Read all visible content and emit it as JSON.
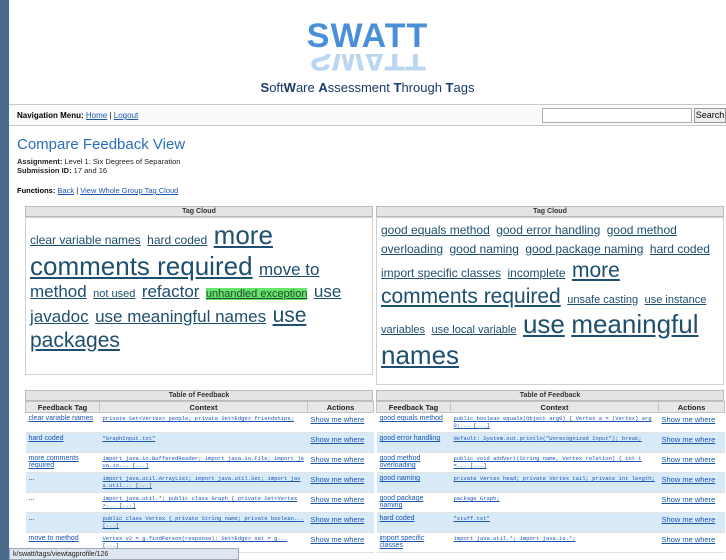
{
  "header": {
    "logo": "SWATT",
    "tagline_parts": [
      "S",
      "oft",
      "W",
      "are ",
      "A",
      "ssessment ",
      "T",
      "hrough ",
      "T",
      "ags"
    ]
  },
  "nav": {
    "label": "Navigation Menu:",
    "home": "Home",
    "sep": " | ",
    "logout": "Logout",
    "search_placeholder": "",
    "search_button": "Search"
  },
  "page": {
    "title": "Compare Feedback View",
    "assignment_label": "Assignment:",
    "assignment_value": " Level 1: Six Degrees of Separation",
    "submission_label": "Submission ID:",
    "submission_value": " 17 and 16",
    "functions_label": "Functions:",
    "back": "Back",
    "sep": " | ",
    "whole_cloud": "View Whole Group Tag Cloud"
  },
  "left": {
    "cloud_title": "Tag Cloud",
    "cloud": [
      {
        "text": "clear variable names",
        "size": 12,
        "hl": false
      },
      {
        "text": "hard coded",
        "size": 12,
        "hl": false
      },
      {
        "text": "more",
        "size": 26,
        "hl": false
      },
      {
        "text": "comments required",
        "size": 26,
        "hl": false
      },
      {
        "text": "move to",
        "size": 17,
        "hl": false
      },
      {
        "text": "method",
        "size": 17,
        "hl": false
      },
      {
        "text": "not used",
        "size": 11,
        "hl": false
      },
      {
        "text": "refactor",
        "size": 17,
        "hl": false
      },
      {
        "text": "unhandled exception",
        "size": 11,
        "hl": true
      },
      {
        "text": "use",
        "size": 17,
        "hl": false
      },
      {
        "text": "javadoc",
        "size": 17,
        "hl": false
      },
      {
        "text": "use meaningful names",
        "size": 17,
        "hl": false
      },
      {
        "text": "use",
        "size": 21,
        "hl": false
      },
      {
        "text": "packages",
        "size": 21,
        "hl": false
      }
    ],
    "table_title": "Table of Feedback",
    "headers": [
      "Feedback Tag",
      "Context",
      "Actions"
    ],
    "rows": [
      {
        "tag": "clear variable names",
        "ctx": "private Set<Vertex> people; private Set<Edge> friendships;",
        "act": "Show me where"
      },
      {
        "tag": "hard coded",
        "ctx": "\"GraphInput.txt\"",
        "act": "Show me where"
      },
      {
        "tag": "more comments required",
        "ctx": "import java.io.BufferedReader; import java.io.File; import java.io... [...]",
        "act": "Show me where"
      },
      {
        "tag": "...",
        "ctx": "import java.util.ArrayList; import java.util.Set; import java.util... [...]",
        "act": "Show me where"
      },
      {
        "tag": "...",
        "ctx": "import java.util.*; public class Graph { private Set<Vertex>... [...]",
        "act": "Show me where"
      },
      {
        "tag": "...",
        "ctx": "public class Vertex { private String name; private boolean... [...]",
        "act": "Show me where"
      },
      {
        "tag": "move to method",
        "ctx": "Vertex v2 = g.findPerson(response); Set<Edge> set = g... [...]",
        "act": "Show me where"
      }
    ]
  },
  "right": {
    "cloud_title": "Tag Cloud",
    "cloud": [
      {
        "text": "good equals method",
        "size": 12,
        "hl": false
      },
      {
        "text": "good error handling",
        "size": 12,
        "hl": false
      },
      {
        "text": "good method overloading",
        "size": 12,
        "hl": false
      },
      {
        "text": "good naming",
        "size": 12,
        "hl": false
      },
      {
        "text": "good package naming",
        "size": 12,
        "hl": false
      },
      {
        "text": "hard coded",
        "size": 12,
        "hl": false
      },
      {
        "text": "import specific classes",
        "size": 12,
        "hl": false
      },
      {
        "text": "incomplete",
        "size": 12,
        "hl": false
      },
      {
        "text": "more",
        "size": 21,
        "hl": false
      },
      {
        "text": "comments required",
        "size": 21,
        "hl": false
      },
      {
        "text": "unsafe casting",
        "size": 11,
        "hl": false
      },
      {
        "text": "use instance variables",
        "size": 11,
        "hl": false
      },
      {
        "text": "use local variable",
        "size": 11,
        "hl": false
      },
      {
        "text": "use",
        "size": 26,
        "hl": false
      },
      {
        "text": "meaningful names",
        "size": 26,
        "hl": false
      }
    ],
    "table_title": "Table of Feedback",
    "headers": [
      "Feedback Tag",
      "Context",
      "Actions"
    ],
    "rows": [
      {
        "tag": "good equals method",
        "ctx": "public boolean equals(Object arg0) { Vertex a = (Vertex) arg0;... [...]",
        "act": "Show me where"
      },
      {
        "tag": "good error handling",
        "ctx": "default: System.out.println(\"Unrecognized Input\"); break;",
        "act": "Show me where"
      },
      {
        "tag": "good method overloading",
        "ctx": "public void addVert(String name, Vertex relation) { int t =... [...]",
        "act": "Show me where"
      },
      {
        "tag": "good naming",
        "ctx": "private Vertex head; private Vertex tail; private int length;",
        "act": "Show me where"
      },
      {
        "tag": "good package naming",
        "ctx": "package Graph;",
        "act": "Show me where"
      },
      {
        "tag": "hard coded",
        "ctx": "\"stuff.txt\"",
        "act": "Show me where"
      },
      {
        "tag": "import specific classes",
        "ctx": "import java.util.*; import java.io.*;",
        "act": "Show me where"
      }
    ]
  },
  "status": {
    "url": "k/swatt/tags/viewtagprofile/126"
  }
}
